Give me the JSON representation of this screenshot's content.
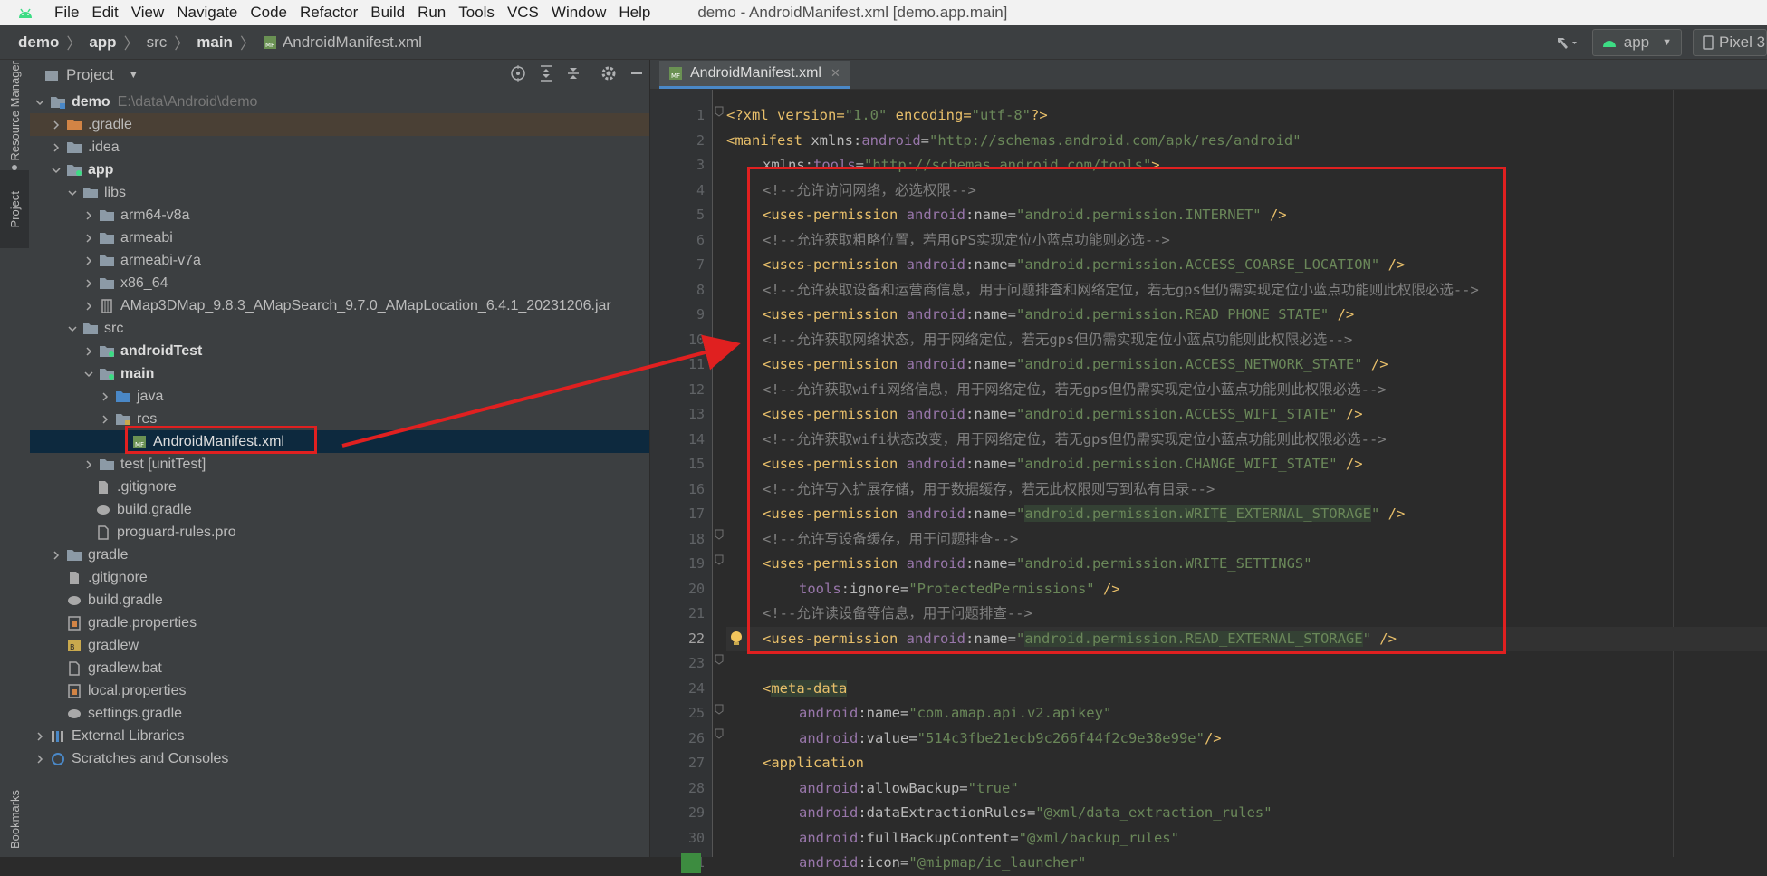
{
  "menubar": {
    "items": [
      "File",
      "Edit",
      "View",
      "Navigate",
      "Code",
      "Refactor",
      "Build",
      "Run",
      "Tools",
      "VCS",
      "Window",
      "Help"
    ],
    "window_title": "demo - AndroidManifest.xml [demo.app.main]"
  },
  "navbar": {
    "crumbs": [
      "demo",
      "app",
      "src",
      "main",
      "AndroidManifest.xml"
    ],
    "run_config": "app",
    "device": "Pixel 3"
  },
  "left_stripe": {
    "resource_manager": "Resource Manager",
    "project": "Project",
    "bookmarks": "Bookmarks"
  },
  "project_panel": {
    "title": "Project",
    "tree": [
      {
        "label": "demo",
        "path": "E:\\data\\Android\\demo",
        "bold": true
      },
      {
        "label": ".gradle"
      },
      {
        "label": ".idea"
      },
      {
        "label": "app",
        "bold": true
      },
      {
        "label": "libs"
      },
      {
        "label": "arm64-v8a"
      },
      {
        "label": "armeabi"
      },
      {
        "label": "armeabi-v7a"
      },
      {
        "label": "x86_64"
      },
      {
        "label": "AMap3DMap_9.8.3_AMapSearch_9.7.0_AMapLocation_6.4.1_20231206.jar"
      },
      {
        "label": "src"
      },
      {
        "label": "androidTest",
        "bold": true
      },
      {
        "label": "main",
        "bold": true
      },
      {
        "label": "java"
      },
      {
        "label": "res"
      },
      {
        "label": "AndroidManifest.xml"
      },
      {
        "label": "test [unitTest]"
      },
      {
        "label": ".gitignore"
      },
      {
        "label": "build.gradle"
      },
      {
        "label": "proguard-rules.pro"
      },
      {
        "label": "gradle"
      },
      {
        "label": ".gitignore"
      },
      {
        "label": "build.gradle"
      },
      {
        "label": "gradle.properties"
      },
      {
        "label": "gradlew"
      },
      {
        "label": "gradlew.bat"
      },
      {
        "label": "local.properties"
      },
      {
        "label": "settings.gradle"
      },
      {
        "label": "External Libraries"
      },
      {
        "label": "Scratches and Consoles"
      }
    ]
  },
  "editor": {
    "tab_label": "AndroidManifest.xml",
    "line_numbers": [
      "1",
      "2",
      "3",
      "4",
      "5",
      "6",
      "7",
      "8",
      "9",
      "10",
      "11",
      "12",
      "13",
      "14",
      "15",
      "16",
      "17",
      "18",
      "19",
      "20",
      "21",
      "22",
      "23",
      "24",
      "25",
      "26",
      "27",
      "28",
      "29",
      "30",
      "31"
    ],
    "code": {
      "l1_a": "<?xml version=",
      "l1_b": "\"1.0\"",
      "l1_c": " encoding=",
      "l1_d": "\"utf-8\"",
      "l1_e": "?>",
      "manifest_tag": "<manifest",
      "xmlns": " xmlns:",
      "android": "android",
      "tools": "tools",
      "l2_val": "\"http://schemas.android.com/apk/res/android\"",
      "l3_xmlns": "xmlns:",
      "l3_val": "\"http://schemas.android.com/tools\"",
      "close": ">",
      "c4": "<!--允许访问网络，必选权限-->",
      "c6": "<!--允许获取粗略位置，若用GPS实现定位小蓝点功能则必选-->",
      "c8": "<!--允许获取设备和运营商信息，用于问题排查和网络定位，若无gps但仍需实现定位小蓝点功能则此权限必选-->",
      "c10": "<!--允许获取网络状态，用于网络定位，若无gps但仍需实现定位小蓝点功能则此权限必选-->",
      "c12": "<!--允许获取wifi网络信息，用于网络定位，若无gps但仍需实现定位小蓝点功能则此权限必选-->",
      "c14": "<!--允许获取wifi状态改变，用于网络定位，若无gps但仍需实现定位小蓝点功能则此权限必选-->",
      "c16": "<!--允许写入扩展存储，用于数据缓存，若无此权限则写到私有目录-->",
      "c18": "<!--允许写设备缓存，用于问题排查-->",
      "c21": "<!--允许读设备等信息，用于问题排查-->",
      "up_tag": "<uses-permission",
      "name_attr": ":name=",
      "selfclose": " />",
      "p5": "\"android.permission.INTERNET\"",
      "p7": "\"android.permission.ACCESS_COARSE_LOCATION\"",
      "p9": "\"android.permission.READ_PHONE_STATE\"",
      "p11": "\"android.permission.ACCESS_NETWORK_STATE\"",
      "p13": "\"android.permission.ACCESS_WIFI_STATE\"",
      "p15": "\"android.permission.CHANGE_WIFI_STATE\"",
      "p17": "android.permission.WRITE_EXTERNAL_STORAGE",
      "p19": "\"android.permission.WRITE_SETTINGS\"",
      "l20_attr": ":ignore=",
      "l20_val": "\"ProtectedPermissions\"",
      "p22": "android.permission.READ_EXTERNAL_STORAGE",
      "quote": "\"",
      "meta_lt": "<",
      "meta_name": "meta-data",
      "l25_val": "\"com.amap.api.v2.apikey\"",
      "l26_attr": ":value=",
      "l26_val": "\"514c3fbe21ecb9c266f44f2c9e38e99e\"",
      "l26_end": "/>",
      "app_tag": "<application",
      "l28_attr": ":allowBackup=",
      "l28_val": "\"true\"",
      "l29_attr": ":dataExtractionRules=",
      "l29_val": "\"@xml/data_extraction_rules\"",
      "l30_attr": ":fullBackupContent=",
      "l30_val": "\"@xml/backup_rules\"",
      "l31_attr": ":icon=",
      "l31_val": "\"@mipmap/ic_launcher\""
    }
  },
  "colors": {
    "annotation": "#e02020",
    "tag": "#e8bf6a",
    "attr_value": "#6a8759",
    "namespace": "#9876aa",
    "comment": "#808080"
  }
}
